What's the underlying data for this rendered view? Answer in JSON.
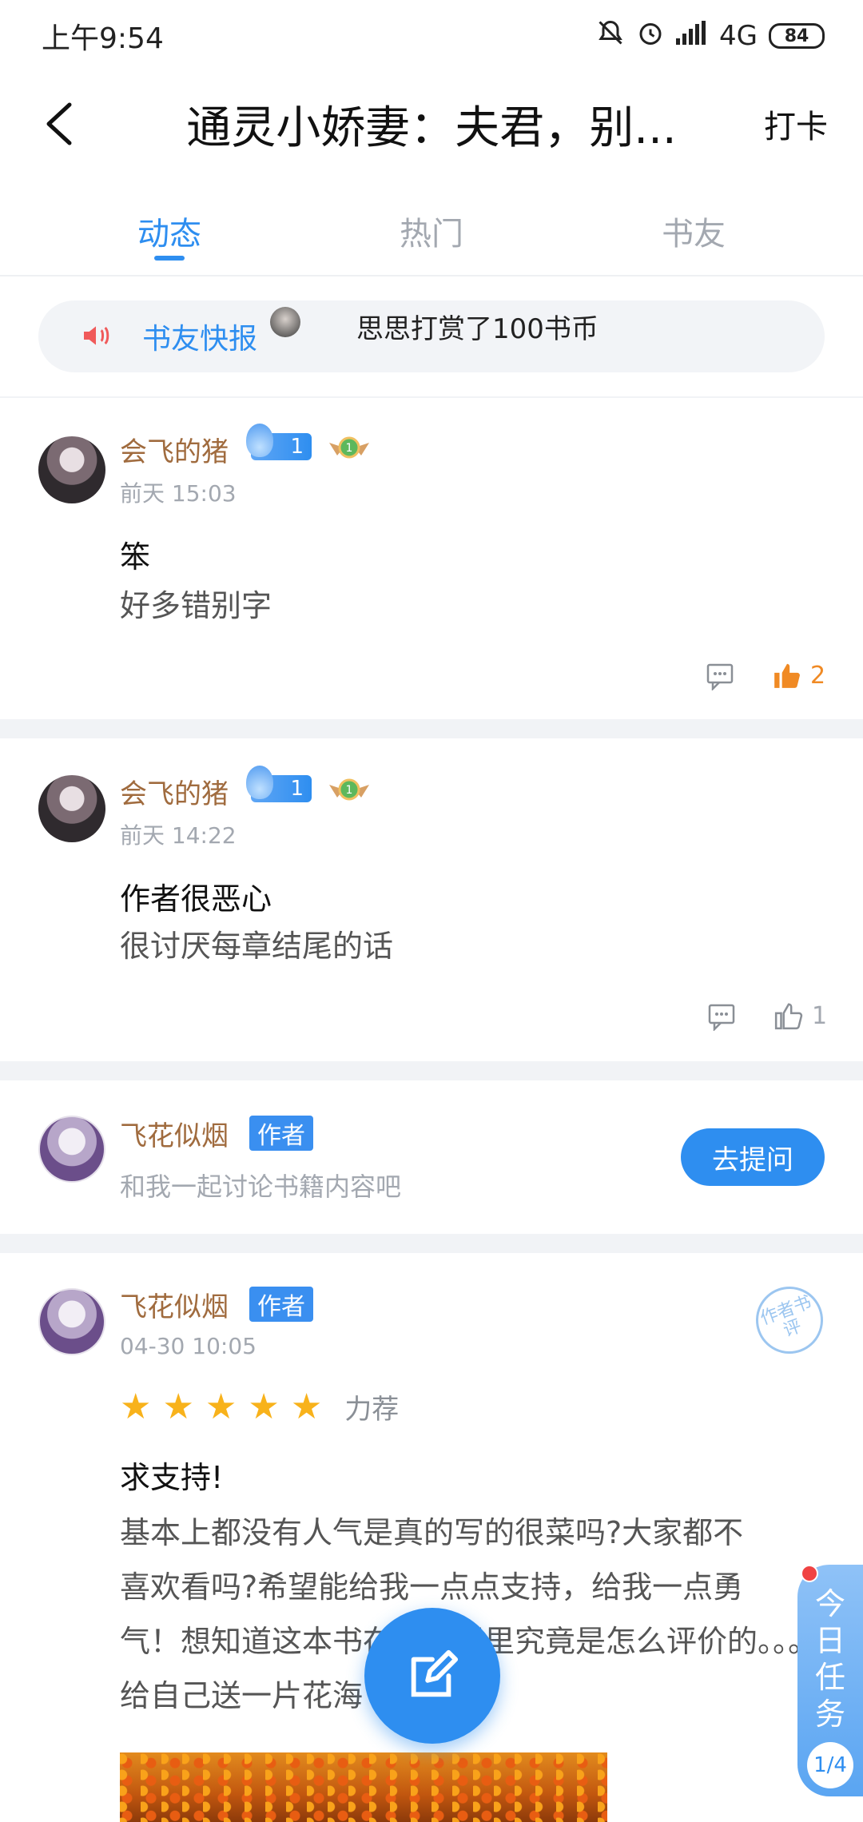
{
  "status_bar": {
    "time": "上午9:54",
    "network": "4G",
    "battery": "84"
  },
  "nav": {
    "title": "通灵小娇妻：夫君，别...",
    "checkin": "打卡"
  },
  "tabs": [
    {
      "label": "动态",
      "active": true
    },
    {
      "label": "热门",
      "active": false
    },
    {
      "label": "书友",
      "active": false
    }
  ],
  "ticker": {
    "label": "书友快报",
    "text": "思思打赏了100书币"
  },
  "posts": [
    {
      "username": "会飞的猪",
      "level": "1",
      "time": "前天 15:03",
      "title": "笨",
      "body": "好多错别字",
      "likes": "2",
      "liked": true
    },
    {
      "username": "会飞的猪",
      "level": "1",
      "time": "前天 14:22",
      "title": "作者很恶心",
      "body": "很讨厌每章结尾的话",
      "likes": "1",
      "liked": false
    }
  ],
  "author_card": {
    "username": "飞花似烟",
    "tag": "作者",
    "subtitle": "和我一起讨论书籍内容吧",
    "button": "去提问"
  },
  "review": {
    "username": "飞花似烟",
    "tag": "作者",
    "time": "04-30 10:05",
    "stamp": "作者书评",
    "rating": 5,
    "rating_label": "力荐",
    "title": "求支持!",
    "body_lines": [
      "基本上都没有人气是真的写的很菜吗?大家都不",
      "喜欢看吗?希望能给我一点点支持，给我一点勇",
      "气！想知道这本书在大家眼里究竟是怎么评价的。。。",
      "给自己送一片花海"
    ]
  },
  "daily_task": {
    "label": "今日任务",
    "progress": "1/4"
  },
  "colors": {
    "accent": "#2e8ef0",
    "username": "#a06b3e",
    "like_active": "#f08a24"
  }
}
